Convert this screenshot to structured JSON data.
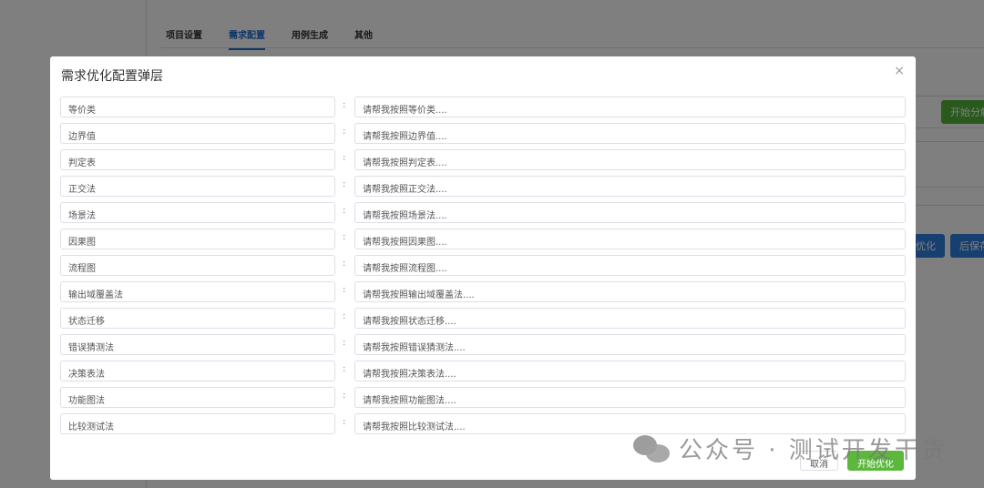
{
  "background": {
    "tabs": [
      {
        "label": "项目设置",
        "active": false
      },
      {
        "label": "需求配置",
        "active": true
      },
      {
        "label": "用例生成",
        "active": false
      },
      {
        "label": "其他",
        "active": false
      }
    ],
    "start_split_button": "开始分解",
    "optimize_button": "优化",
    "save_after_button": "后保存"
  },
  "modal": {
    "title": "需求优化配置弹层",
    "close_icon": "×",
    "colon": ":",
    "rows": [
      {
        "name": "等价类",
        "prompt": "请帮我按照等价类...."
      },
      {
        "name": "边界值",
        "prompt": "请帮我按照边界值...."
      },
      {
        "name": "判定表",
        "prompt": "请帮我按照判定表...."
      },
      {
        "name": "正交法",
        "prompt": "请帮我按照正交法...."
      },
      {
        "name": "场景法",
        "prompt": "请帮我按照场景法...."
      },
      {
        "name": "因果图",
        "prompt": "请帮我按照因果图...."
      },
      {
        "name": "流程图",
        "prompt": "请帮我按照流程图...."
      },
      {
        "name": "输出域覆盖法",
        "prompt": "请帮我按照输出域覆盖法...."
      },
      {
        "name": "状态迁移",
        "prompt": "请帮我按照状态迁移...."
      },
      {
        "name": "错误猜测法",
        "prompt": "请帮我按照错误猜测法...."
      },
      {
        "name": "决策表法",
        "prompt": "请帮我按照决策表法...."
      },
      {
        "name": "功能图法",
        "prompt": "请帮我按照功能图法...."
      },
      {
        "name": "比较测试法",
        "prompt": "请帮我按照比较测试法...."
      }
    ],
    "cancel_button": "取消",
    "ok_button": "开始优化"
  },
  "watermark": "公众号 · 测试开发干货"
}
